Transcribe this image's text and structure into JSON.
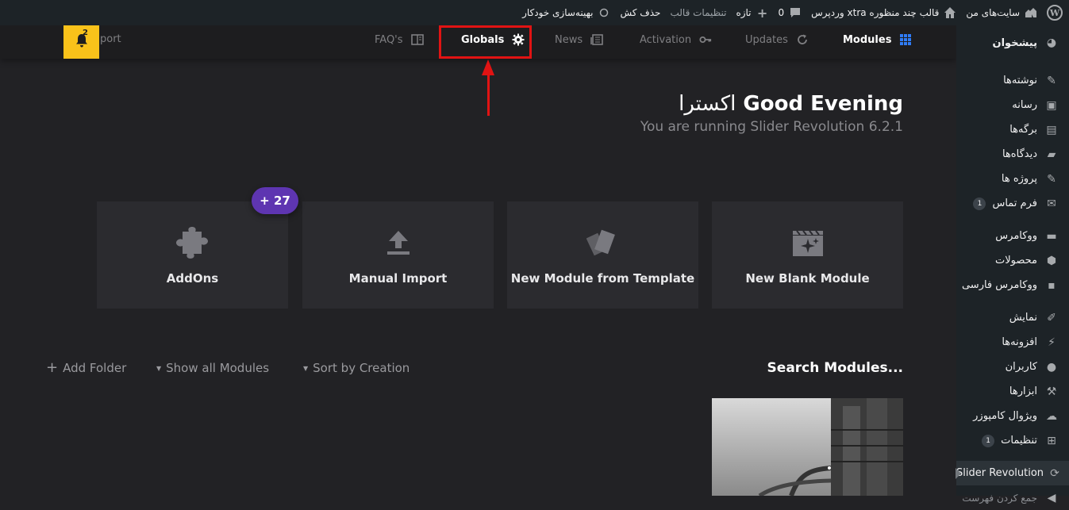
{
  "adminbar": {
    "wp_logo": "W",
    "site_name": "سایت‌های من",
    "theme_name": "قالب چند منظوره xtra وردپرس",
    "comments_count": "0",
    "new_label": "تازه",
    "theme_settings": "تنظیمات قالب",
    "purge": "حذف کش",
    "optimizer": "بهینه‌سازی خودکار"
  },
  "topnav": {
    "tabs": [
      {
        "label": "Modules",
        "icon": "grid-icon"
      },
      {
        "label": "Updates",
        "icon": "refresh-icon"
      },
      {
        "label": "Activation",
        "icon": "key-icon"
      },
      {
        "label": "News",
        "icon": "news-icon"
      },
      {
        "label": "Globals",
        "icon": "gear-icon"
      },
      {
        "label": "FAQ's",
        "icon": "book-icon"
      }
    ],
    "notifications_count": "2",
    "import_fragment": "port"
  },
  "greeting": {
    "text": "Good Evening",
    "name": "اکسترا",
    "running": "You are running Slider Revolution 6.2.1"
  },
  "cards": [
    {
      "label": "New Blank Module",
      "icon": "clapperboard-icon"
    },
    {
      "label": "New Module from Template",
      "icon": "template-icon"
    },
    {
      "label": "Manual Import",
      "icon": "upload-icon"
    },
    {
      "label": "AddOns",
      "icon": "puzzle-icon"
    }
  ],
  "addons_badge": "+ 27",
  "toolbar": {
    "add_folder": "Add Folder",
    "show_all": "Show all Modules",
    "sort_by": "Sort by Creation",
    "search_title": "Search Modules..."
  },
  "sidebar": {
    "items": [
      {
        "label": "پیشخوان",
        "icon": "dashboard-icon"
      },
      {
        "label": "نوشته‌ها",
        "icon": "pin-icon"
      },
      {
        "label": "رسانه",
        "icon": "media-icon"
      },
      {
        "label": "برگه‌ها",
        "icon": "page-icon"
      },
      {
        "label": "دیدگاه‌ها",
        "icon": "comment-icon"
      },
      {
        "label": "پروژه ها",
        "icon": "pin-icon"
      },
      {
        "label": "فرم تماس",
        "icon": "mail-icon",
        "badge": "1"
      },
      {
        "label": "ووکامرس",
        "icon": "woo-icon"
      },
      {
        "label": "محصولات",
        "icon": "box-icon"
      },
      {
        "label": "ووکامرس فارسی",
        "icon": "woo-fa-icon"
      },
      {
        "label": "نمایش",
        "icon": "brush-icon"
      },
      {
        "label": "افزونه‌ها",
        "icon": "plugin-icon"
      },
      {
        "label": "کاربران",
        "icon": "user-icon"
      },
      {
        "label": "ابزارها",
        "icon": "wrench-icon"
      },
      {
        "label": "ویژوال کامپوزر",
        "icon": "cloud-icon"
      },
      {
        "label": "تنظیمات",
        "icon": "settings-icon",
        "badge": "1"
      },
      {
        "label": "Slider Revolution",
        "icon": "slider-icon"
      },
      {
        "label": "جمع کردن فهرست",
        "icon": "collapse-icon"
      }
    ]
  }
}
